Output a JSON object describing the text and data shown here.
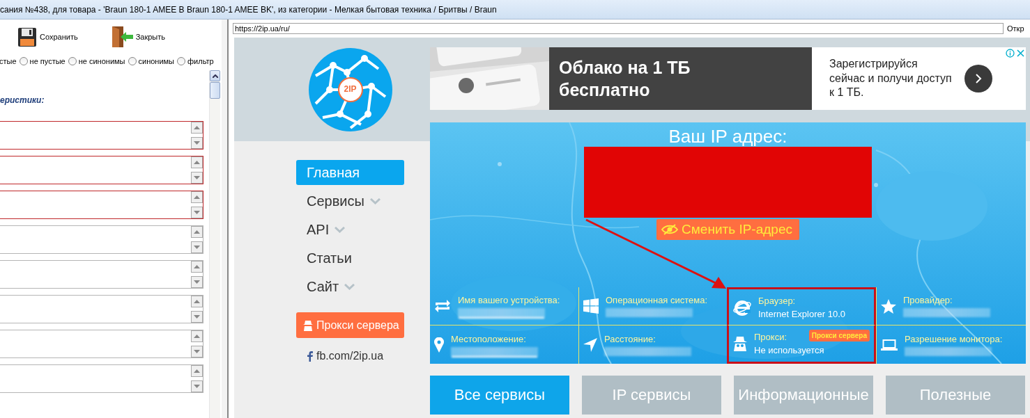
{
  "window": {
    "title": "сания №438, для товара - 'Braun 180-1 AMEE B Braun 180-1 AMEE BK', из категории - Мелкая бытовая техника / Бритвы / Braun"
  },
  "toolbar": [
    {
      "label": "Сохранить",
      "kind": "save"
    },
    {
      "label": "Закрыть",
      "kind": "close"
    }
  ],
  "filter_tail": "стые",
  "filters": [
    {
      "label": "не пустые",
      "selected": false
    },
    {
      "label": "не синонимы",
      "selected": false
    },
    {
      "label": "синонимы",
      "selected": false
    },
    {
      "label": "фильтр",
      "selected": false
    }
  ],
  "section_label": "еристики:",
  "fields": [
    {
      "invalid": true
    },
    {
      "invalid": true
    },
    {
      "invalid": true
    },
    {
      "invalid": false
    },
    {
      "invalid": false
    },
    {
      "invalid": false
    },
    {
      "invalid": false
    },
    {
      "invalid": false
    }
  ],
  "browser": {
    "address": "https://2ip.ua/ru/",
    "open_button": "Откр"
  },
  "site": {
    "logo_text": "2IP",
    "nav": [
      {
        "label": "Главная",
        "selected": true,
        "dropdown": false
      },
      {
        "label": "Сервисы",
        "selected": false,
        "dropdown": true
      },
      {
        "label": "API",
        "selected": false,
        "dropdown": true
      },
      {
        "label": "Статьи",
        "selected": false,
        "dropdown": false
      },
      {
        "label": "Сайт",
        "selected": false,
        "dropdown": true
      }
    ],
    "proxy_button": "Прокси сервера",
    "facebook_link": "fb.com/2ip.ua"
  },
  "ad": {
    "headline": "Облако на 1 ТБ бесплатно",
    "text": "Зарегистрируйся сейчас и получи доступ к 1 ТБ."
  },
  "ip_panel": {
    "heading": "Ваш IP адрес:",
    "change_button": "Сменить IP-адрес",
    "info": [
      {
        "kind": "device",
        "label": "Имя вашего устройства:",
        "blurred": true,
        "highlighted": false
      },
      {
        "kind": "os",
        "label": "Операционная система:",
        "blurred": true,
        "highlighted": false
      },
      {
        "kind": "browser",
        "label": "Браузер:",
        "value": "Internet Explorer 10.0",
        "blurred": false,
        "highlighted": true
      },
      {
        "kind": "provider",
        "label": "Провайдер:",
        "blurred": true,
        "highlighted": false
      },
      {
        "kind": "location",
        "label": "Местоположение:",
        "blurred": true,
        "highlighted": false
      },
      {
        "kind": "distance",
        "label": "Расстояние:",
        "blurred": true,
        "highlighted": false
      },
      {
        "kind": "proxy",
        "label": "Прокси:",
        "value": "Не используется",
        "badge": "Прокси сервера",
        "blurred": false,
        "highlighted": true
      },
      {
        "kind": "monitor",
        "label": "Разрешение монитора:",
        "blurred": true,
        "highlighted": false
      }
    ]
  },
  "tabs": [
    {
      "label": "Все сервисы",
      "selected": true
    },
    {
      "label": "IP сервисы",
      "selected": false
    },
    {
      "label": "Информационные",
      "selected": false
    },
    {
      "label": "Полезные",
      "selected": false
    }
  ]
}
